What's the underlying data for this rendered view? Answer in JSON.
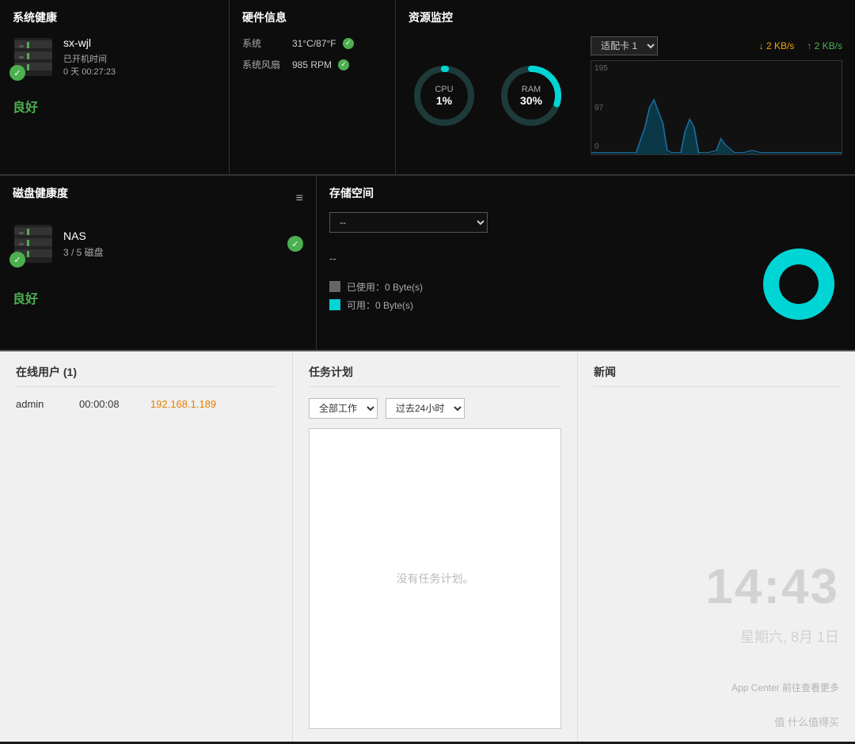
{
  "system_health": {
    "title": "系统健康",
    "hostname": "sx-wjl",
    "uptime_label": "已开机时间",
    "uptime_value": "0 天 00:27:23",
    "status": "良好"
  },
  "hardware_info": {
    "title": "硬件信息",
    "temp_label": "系统",
    "temp_value": "31°C/87°F",
    "fan_label": "系统风扇",
    "fan_value": "985 RPM"
  },
  "resource_monitor": {
    "title": "资源监控",
    "cpu_label": "CPU",
    "cpu_value": "1%",
    "ram_label": "RAM",
    "ram_value": "30%",
    "adapter_label": "适配卡 1",
    "net_down": "↓ 2 KB/s",
    "net_up": "↑ 2 KB/s",
    "chart_y_top": "195",
    "chart_y_mid": "97"
  },
  "disk_health": {
    "title": "磁盘健康度",
    "name": "NAS",
    "disk_count": "3 / 5 磁盘",
    "status": "良好"
  },
  "storage_space": {
    "title": "存储空间",
    "select_placeholder": "--",
    "volume_label": "--",
    "used_label": "已使用：0 Byte(s)",
    "avail_label": "可用：0 Byte(s)"
  },
  "online_users": {
    "title": "在线用户 (1)",
    "users": [
      {
        "name": "admin",
        "time": "00:00:08",
        "ip": "192.168.1.189"
      }
    ]
  },
  "task_schedule": {
    "title": "任务计划",
    "filter_all": "全部工作",
    "filter_time": "过去24小时",
    "empty_text": "没有任务计划。",
    "select_options": [
      "全部工作"
    ],
    "time_options": [
      "过去24小时"
    ]
  },
  "news": {
    "title": "新闻",
    "clock_time": "14:43",
    "clock_date": "星期六, 8月 1日",
    "app_center_text": "App Center 前往查看更多",
    "watermark": "值 什么值得买"
  }
}
